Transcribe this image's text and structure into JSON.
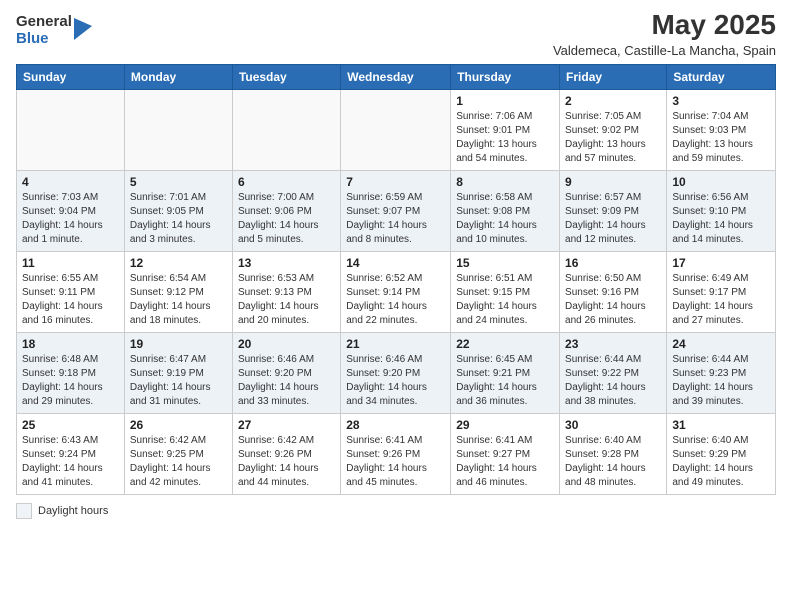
{
  "header": {
    "logo_general": "General",
    "logo_blue": "Blue",
    "month": "May 2025",
    "location": "Valdemeca, Castille-La Mancha, Spain"
  },
  "days_of_week": [
    "Sunday",
    "Monday",
    "Tuesday",
    "Wednesday",
    "Thursday",
    "Friday",
    "Saturday"
  ],
  "footer": {
    "daylight_label": "Daylight hours"
  },
  "weeks": [
    [
      {
        "day": "",
        "detail": ""
      },
      {
        "day": "",
        "detail": ""
      },
      {
        "day": "",
        "detail": ""
      },
      {
        "day": "",
        "detail": ""
      },
      {
        "day": "1",
        "detail": "Sunrise: 7:06 AM\nSunset: 9:01 PM\nDaylight: 13 hours\nand 54 minutes."
      },
      {
        "day": "2",
        "detail": "Sunrise: 7:05 AM\nSunset: 9:02 PM\nDaylight: 13 hours\nand 57 minutes."
      },
      {
        "day": "3",
        "detail": "Sunrise: 7:04 AM\nSunset: 9:03 PM\nDaylight: 13 hours\nand 59 minutes."
      }
    ],
    [
      {
        "day": "4",
        "detail": "Sunrise: 7:03 AM\nSunset: 9:04 PM\nDaylight: 14 hours\nand 1 minute."
      },
      {
        "day": "5",
        "detail": "Sunrise: 7:01 AM\nSunset: 9:05 PM\nDaylight: 14 hours\nand 3 minutes."
      },
      {
        "day": "6",
        "detail": "Sunrise: 7:00 AM\nSunset: 9:06 PM\nDaylight: 14 hours\nand 5 minutes."
      },
      {
        "day": "7",
        "detail": "Sunrise: 6:59 AM\nSunset: 9:07 PM\nDaylight: 14 hours\nand 8 minutes."
      },
      {
        "day": "8",
        "detail": "Sunrise: 6:58 AM\nSunset: 9:08 PM\nDaylight: 14 hours\nand 10 minutes."
      },
      {
        "day": "9",
        "detail": "Sunrise: 6:57 AM\nSunset: 9:09 PM\nDaylight: 14 hours\nand 12 minutes."
      },
      {
        "day": "10",
        "detail": "Sunrise: 6:56 AM\nSunset: 9:10 PM\nDaylight: 14 hours\nand 14 minutes."
      }
    ],
    [
      {
        "day": "11",
        "detail": "Sunrise: 6:55 AM\nSunset: 9:11 PM\nDaylight: 14 hours\nand 16 minutes."
      },
      {
        "day": "12",
        "detail": "Sunrise: 6:54 AM\nSunset: 9:12 PM\nDaylight: 14 hours\nand 18 minutes."
      },
      {
        "day": "13",
        "detail": "Sunrise: 6:53 AM\nSunset: 9:13 PM\nDaylight: 14 hours\nand 20 minutes."
      },
      {
        "day": "14",
        "detail": "Sunrise: 6:52 AM\nSunset: 9:14 PM\nDaylight: 14 hours\nand 22 minutes."
      },
      {
        "day": "15",
        "detail": "Sunrise: 6:51 AM\nSunset: 9:15 PM\nDaylight: 14 hours\nand 24 minutes."
      },
      {
        "day": "16",
        "detail": "Sunrise: 6:50 AM\nSunset: 9:16 PM\nDaylight: 14 hours\nand 26 minutes."
      },
      {
        "day": "17",
        "detail": "Sunrise: 6:49 AM\nSunset: 9:17 PM\nDaylight: 14 hours\nand 27 minutes."
      }
    ],
    [
      {
        "day": "18",
        "detail": "Sunrise: 6:48 AM\nSunset: 9:18 PM\nDaylight: 14 hours\nand 29 minutes."
      },
      {
        "day": "19",
        "detail": "Sunrise: 6:47 AM\nSunset: 9:19 PM\nDaylight: 14 hours\nand 31 minutes."
      },
      {
        "day": "20",
        "detail": "Sunrise: 6:46 AM\nSunset: 9:20 PM\nDaylight: 14 hours\nand 33 minutes."
      },
      {
        "day": "21",
        "detail": "Sunrise: 6:46 AM\nSunset: 9:20 PM\nDaylight: 14 hours\nand 34 minutes."
      },
      {
        "day": "22",
        "detail": "Sunrise: 6:45 AM\nSunset: 9:21 PM\nDaylight: 14 hours\nand 36 minutes."
      },
      {
        "day": "23",
        "detail": "Sunrise: 6:44 AM\nSunset: 9:22 PM\nDaylight: 14 hours\nand 38 minutes."
      },
      {
        "day": "24",
        "detail": "Sunrise: 6:44 AM\nSunset: 9:23 PM\nDaylight: 14 hours\nand 39 minutes."
      }
    ],
    [
      {
        "day": "25",
        "detail": "Sunrise: 6:43 AM\nSunset: 9:24 PM\nDaylight: 14 hours\nand 41 minutes."
      },
      {
        "day": "26",
        "detail": "Sunrise: 6:42 AM\nSunset: 9:25 PM\nDaylight: 14 hours\nand 42 minutes."
      },
      {
        "day": "27",
        "detail": "Sunrise: 6:42 AM\nSunset: 9:26 PM\nDaylight: 14 hours\nand 44 minutes."
      },
      {
        "day": "28",
        "detail": "Sunrise: 6:41 AM\nSunset: 9:26 PM\nDaylight: 14 hours\nand 45 minutes."
      },
      {
        "day": "29",
        "detail": "Sunrise: 6:41 AM\nSunset: 9:27 PM\nDaylight: 14 hours\nand 46 minutes."
      },
      {
        "day": "30",
        "detail": "Sunrise: 6:40 AM\nSunset: 9:28 PM\nDaylight: 14 hours\nand 48 minutes."
      },
      {
        "day": "31",
        "detail": "Sunrise: 6:40 AM\nSunset: 9:29 PM\nDaylight: 14 hours\nand 49 minutes."
      }
    ]
  ]
}
